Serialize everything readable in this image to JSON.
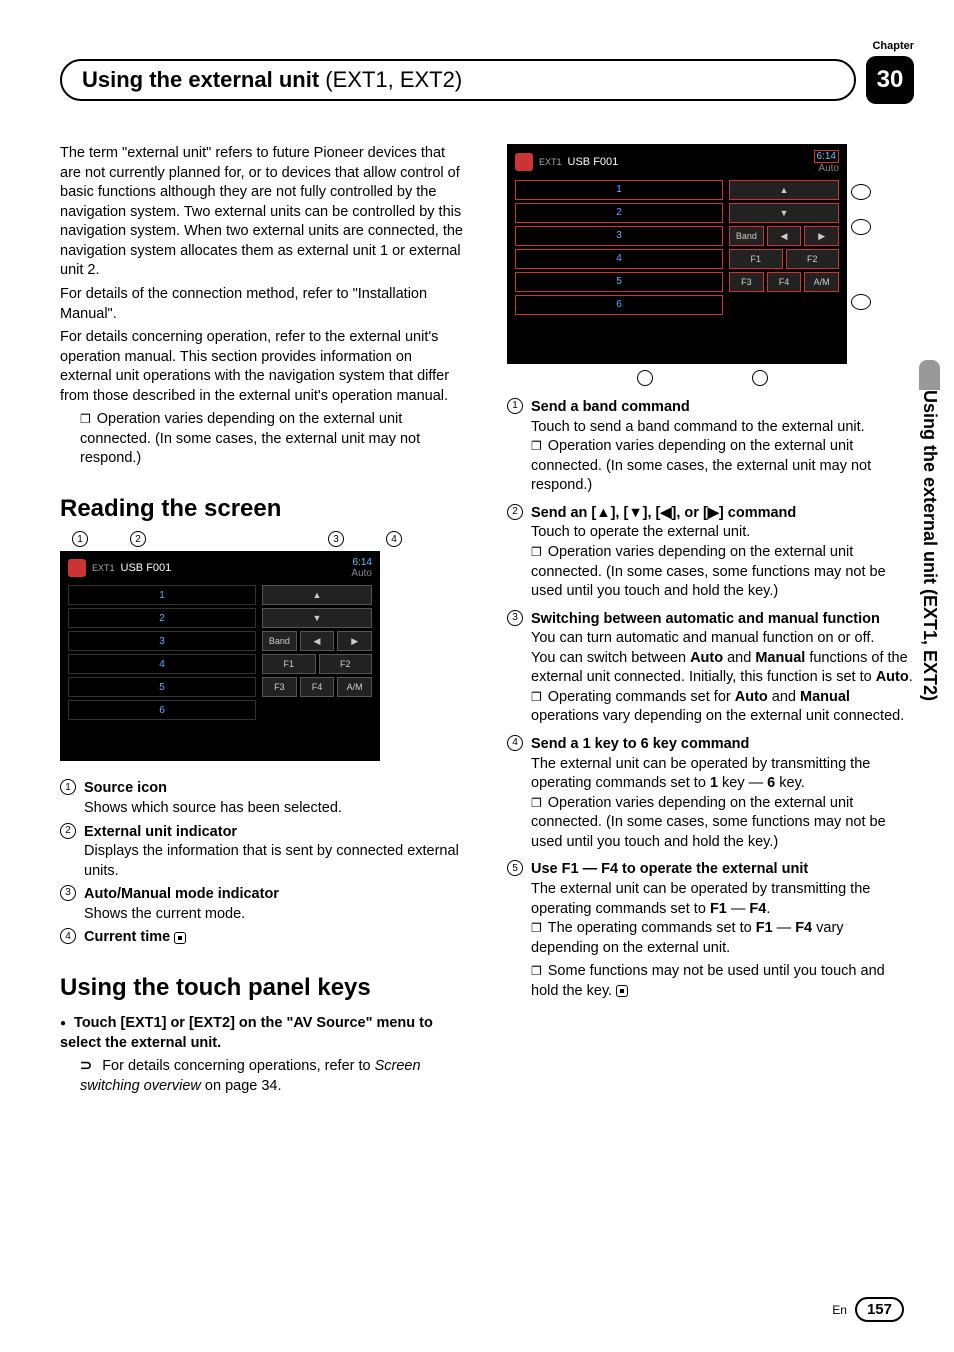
{
  "chapterLabel": "Chapter",
  "chapterNum": "30",
  "titleBold": "Using the external unit ",
  "titleLight": "(EXT1, EXT2)",
  "vtab": "Using the external unit (EXT1, EXT2)",
  "left": {
    "intro": "The term \"external unit\" refers to future Pioneer devices that are not currently planned for, or to devices that allow control of basic functions although they are not fully controlled by the navigation system. Two external units can be controlled by this navigation system. When two external units are connected, the navigation system allocates them as external unit 1 or external unit 2.",
    "install": "For details of the connection method, refer to \"Installation Manual\".",
    "oper": "For details concerning operation, refer to the external unit's operation manual. This section provides information on external unit operations with the navigation system that differ from those described in the external unit's operation manual.",
    "note1": "Operation varies depending on the external unit connected. (In some cases, the external unit may not respond.)",
    "h2a": "Reading the screen",
    "item1t": "Source icon",
    "item1d": "Shows which source has been selected.",
    "item2t": "External unit indicator",
    "item2d": "Displays the information that is sent by connected external units.",
    "item3t": "Auto/Manual mode indicator",
    "item3d": "Shows the current mode.",
    "item4t": "Current time",
    "h2b": "Using the touch panel keys",
    "touchLine": "Touch [EXT1] or [EXT2] on the \"AV Source\" menu to select the external unit.",
    "detailsLine": "For details concerning operations, refer to ",
    "detailsItalic": "Screen switching overview",
    "detailsPage": " on page 34."
  },
  "right": {
    "item1t": "Send a band command",
    "item1d": "Touch to send a band command to the external unit.",
    "item1n": "Operation varies depending on the external unit connected. (In some cases, the external unit may not respond.)",
    "item2t": "Send an [▲], [▼], [◀], or [▶] command",
    "item2d": "Touch to operate the external unit.",
    "item2n": "Operation varies depending on the external unit connected. (In some cases, some functions may not be used until you touch and hold the key.)",
    "item3t": "Switching between automatic and manual function",
    "item3d1": "You can turn automatic and manual function on or off.",
    "item3d2a": "You can switch between ",
    "item3d2b": " and ",
    "item3d2c": " functions of the external unit connected. Initially, this function is set to ",
    "auto": "Auto",
    "manual": "Manual",
    "item3n1a": "Operating commands set for ",
    "item3n1b": " operations vary depending on the external unit connected.",
    "item4t": "Send a 1 key to 6 key command",
    "item4d1": "The external unit can be operated by transmitting the operating commands set to ",
    "one": "1",
    "item4d2": " key — ",
    "six": "6",
    "item4d3": " key.",
    "item4n": "Operation varies depending on the external unit connected. (In some cases, some functions may not be used until you touch and hold the key.)",
    "item5t": "Use F1 — F4 to operate the external unit",
    "item5d1": "The external unit can be operated by transmitting the operating commands set to ",
    "f1": "F1",
    "item5d2": " — ",
    "f4": "F4",
    "item5n1a": "The operating commands set to ",
    "item5n1b": " vary depending on the external unit.",
    "item5n2": "Some functions may not be used until you touch and hold the key."
  },
  "shot": {
    "label": "USB F001",
    "ext": "EXT1",
    "time": "6:14",
    "mode": "Auto",
    "rows": [
      "1",
      "2",
      "3",
      "4",
      "5",
      "6"
    ],
    "band": "Band",
    "f1": "F1",
    "f2": "F2",
    "f3": "F3",
    "f4": "F4",
    "am": "A/M"
  },
  "footer": {
    "en": "En",
    "page": "157"
  }
}
